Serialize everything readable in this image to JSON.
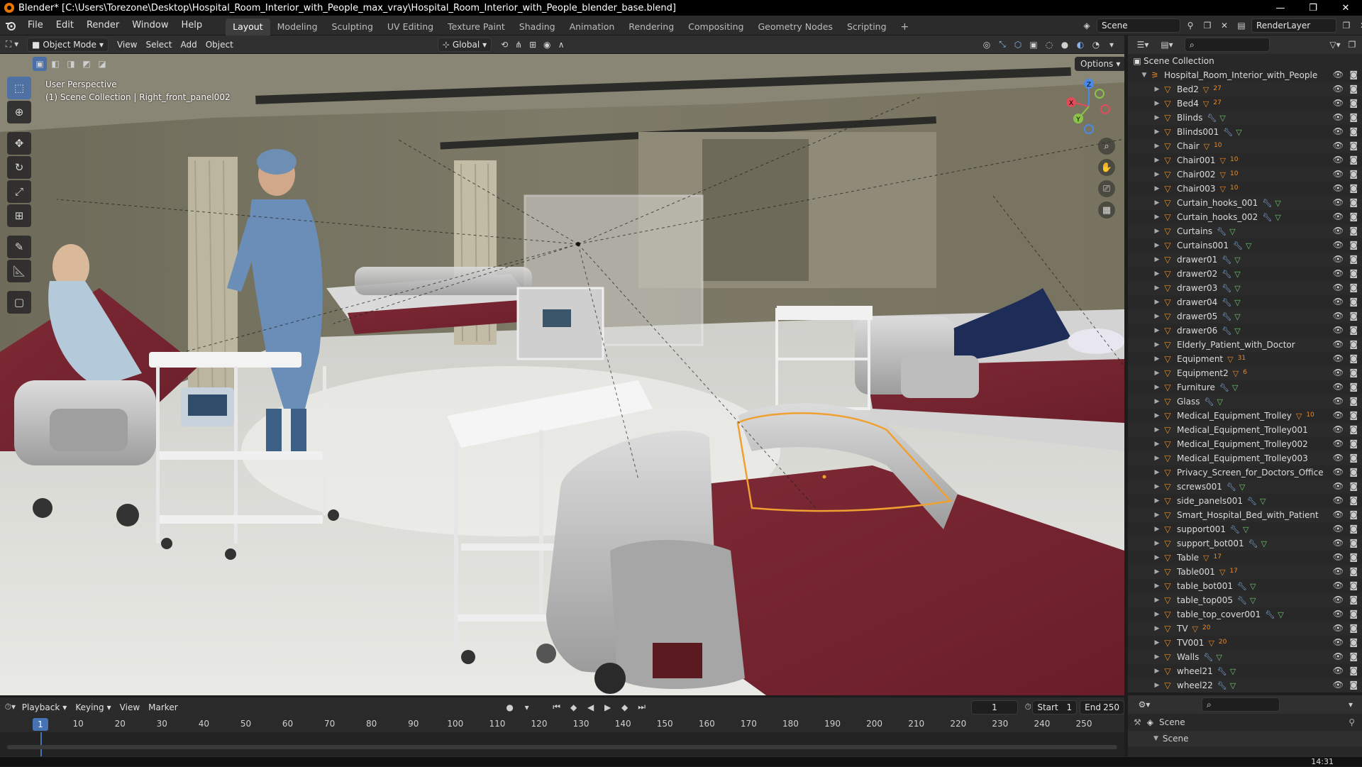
{
  "window": {
    "title": "Blender* [C:\\Users\\Torezone\\Desktop\\Hospital_Room_Interior_with_People_max_vray\\Hospital_Room_Interior_with_People_blender_base.blend]",
    "controls": {
      "minimize": "—",
      "maximize": "❐",
      "close": "✕"
    }
  },
  "menu": [
    "File",
    "Edit",
    "Render",
    "Window",
    "Help"
  ],
  "workspaces": [
    {
      "label": "Layout",
      "active": true
    },
    {
      "label": "Modeling"
    },
    {
      "label": "Sculpting"
    },
    {
      "label": "UV Editing"
    },
    {
      "label": "Texture Paint"
    },
    {
      "label": "Shading"
    },
    {
      "label": "Animation"
    },
    {
      "label": "Rendering"
    },
    {
      "label": "Compositing"
    },
    {
      "label": "Geometry Nodes"
    },
    {
      "label": "Scripting"
    }
  ],
  "add_workspace": "+",
  "scene_selector": {
    "scene": "Scene",
    "view_layer": "RenderLayer"
  },
  "viewport_header": {
    "mode": "Object Mode",
    "menus": [
      "View",
      "Select",
      "Add",
      "Object"
    ],
    "transform_orientation": "Global",
    "options": "Options"
  },
  "viewport": {
    "perspective": "User Perspective",
    "selection": "(1) Scene Collection | Right_front_panel002",
    "gizmo_axes": {
      "x": "X",
      "y": "Y",
      "z": "Z"
    },
    "colors": {
      "x": "#e44b5a",
      "y": "#8bc34a",
      "z": "#4a8ae6",
      "select": "#f0a030"
    }
  },
  "tools": [
    "select-box",
    "cursor",
    "move",
    "rotate",
    "scale",
    "transform",
    "annotate",
    "measure",
    "add-cube"
  ],
  "outliner": {
    "root": "Scene Collection",
    "collection": "Hospital_Room_Interior_with_People",
    "items": [
      {
        "name": "Bed2",
        "badge": "27",
        "mods": 0
      },
      {
        "name": "Bed4",
        "badge": "27",
        "mods": 0
      },
      {
        "name": "Blinds",
        "mods": 2
      },
      {
        "name": "Blinds001",
        "mods": 2
      },
      {
        "name": "Chair",
        "badge": "10",
        "mods": 0
      },
      {
        "name": "Chair001",
        "badge": "10",
        "mods": 0
      },
      {
        "name": "Chair002",
        "badge": "10",
        "mods": 0
      },
      {
        "name": "Chair003",
        "badge": "10",
        "mods": 0
      },
      {
        "name": "Curtain_hooks_001",
        "mods": 2
      },
      {
        "name": "Curtain_hooks_002",
        "mods": 2
      },
      {
        "name": "Curtains",
        "mods": 2
      },
      {
        "name": "Curtains001",
        "mods": 2
      },
      {
        "name": "drawer01",
        "mods": 2
      },
      {
        "name": "drawer02",
        "mods": 2
      },
      {
        "name": "drawer03",
        "mods": 2
      },
      {
        "name": "drawer04",
        "mods": 2
      },
      {
        "name": "drawer05",
        "mods": 2
      },
      {
        "name": "drawer06",
        "mods": 2
      },
      {
        "name": "Elderly_Patient_with_Doctor",
        "mods": 0
      },
      {
        "name": "Equipment",
        "badge": "31",
        "mods": 0
      },
      {
        "name": "Equipment2",
        "badge": "6",
        "mods": 0
      },
      {
        "name": "Furniture",
        "mods": 2
      },
      {
        "name": "Glass",
        "mods": 2
      },
      {
        "name": "Medical_Equipment_Trolley",
        "badge": "10",
        "mods": 0
      },
      {
        "name": "Medical_Equipment_Trolley001",
        "mods": 0
      },
      {
        "name": "Medical_Equipment_Trolley002",
        "mods": 0
      },
      {
        "name": "Medical_Equipment_Trolley003",
        "mods": 0
      },
      {
        "name": "Privacy_Screen_for_Doctors_Office",
        "mods": 0
      },
      {
        "name": "screws001",
        "mods": 2
      },
      {
        "name": "side_panels001",
        "mods": 2
      },
      {
        "name": "Smart_Hospital_Bed_with_Patient",
        "mods": 0
      },
      {
        "name": "support001",
        "mods": 2
      },
      {
        "name": "support_bot001",
        "mods": 2
      },
      {
        "name": "Table",
        "badge": "17",
        "mods": 0
      },
      {
        "name": "Table001",
        "badge": "17",
        "mods": 0
      },
      {
        "name": "table_bot001",
        "mods": 2
      },
      {
        "name": "table_top005",
        "mods": 2
      },
      {
        "name": "table_top_cover001",
        "mods": 2
      },
      {
        "name": "TV",
        "badge": "20",
        "mods": 0
      },
      {
        "name": "TV001",
        "badge": "20",
        "mods": 0
      },
      {
        "name": "Walls",
        "mods": 2
      },
      {
        "name": "wheel21",
        "mods": 2
      },
      {
        "name": "wheel22",
        "mods": 2
      }
    ]
  },
  "properties": {
    "context": "Scene",
    "panel": "Scene"
  },
  "timeline": {
    "menus": [
      "Playback",
      "Keying",
      "View",
      "Marker"
    ],
    "current_frame": "1",
    "start_label": "Start",
    "start": "1",
    "end_label": "End",
    "end": "250",
    "ticks": [
      "1",
      "10",
      "20",
      "30",
      "40",
      "50",
      "60",
      "70",
      "80",
      "90",
      "100",
      "110",
      "120",
      "130",
      "140",
      "150",
      "160",
      "170",
      "180",
      "190",
      "200",
      "210",
      "220",
      "230",
      "240",
      "250"
    ]
  },
  "taskbar": {
    "clock": "14:31"
  }
}
